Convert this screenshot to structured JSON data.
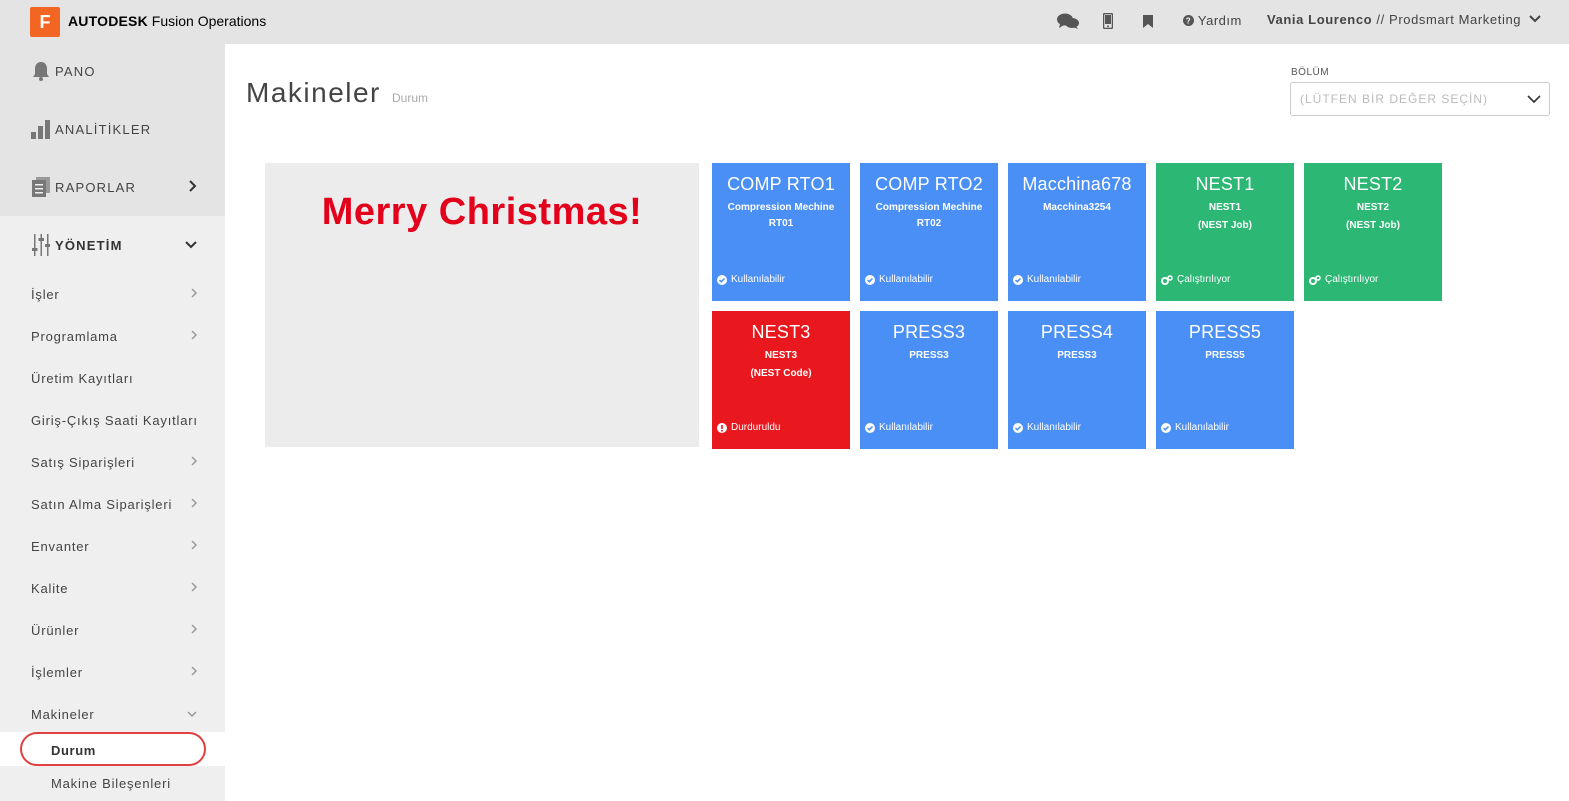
{
  "header": {
    "logo_letter": "F",
    "brand_bold": "AUTODESK",
    "brand_rest": " Fusion Operations",
    "help_label": "Yardım",
    "user_name": "Vania Lourenco",
    "user_company": " // Prodsmart Marketing"
  },
  "sidebar": {
    "main_items": [
      {
        "label": "PANO",
        "icon": "bell-icon"
      },
      {
        "label": "ANALİTİKLER",
        "icon": "bar-chart-icon"
      },
      {
        "label": "RAPORLAR",
        "icon": "documents-icon"
      },
      {
        "label": "YÖNETİM",
        "icon": "sliders-icon"
      }
    ],
    "sub_items": [
      {
        "label": "İşler"
      },
      {
        "label": "Programlama"
      },
      {
        "label": "Üretim Kayıtları"
      },
      {
        "label": "Giriş-Çıkış Saati Kayıtları"
      },
      {
        "label": "Satış Siparişleri"
      },
      {
        "label": "Satın Alma Siparişleri"
      },
      {
        "label": "Envanter"
      },
      {
        "label": "Kalite"
      },
      {
        "label": "Ürünler"
      },
      {
        "label": "İşlemler"
      },
      {
        "label": "Makineler"
      }
    ],
    "leaf_items": [
      {
        "label": "Durum"
      },
      {
        "label": "Makine Bileşenleri"
      }
    ]
  },
  "page": {
    "title": "Makineler",
    "subtitle": "Durum",
    "section_label": "BÖLÜM",
    "section_placeholder": "(LÜTFEN BİR DEĞER SEÇİN)"
  },
  "banner": {
    "text": "Merry Christmas!"
  },
  "machines": [
    {
      "name": "COMP RTO1",
      "desc": "Compression Mechine RT01",
      "job": "",
      "status": "Kullanılabilir",
      "status_type": "available",
      "color": "#4a8ff5"
    },
    {
      "name": "COMP RTO2",
      "desc": "Compression Mechine RT02",
      "job": "",
      "status": "Kullanılabilir",
      "status_type": "available",
      "color": "#4a8ff5"
    },
    {
      "name": "Macchina678",
      "desc": "Macchina3254",
      "job": "",
      "status": "Kullanılabilir",
      "status_type": "available",
      "color": "#4a8ff5"
    },
    {
      "name": "NEST1",
      "desc": "NEST1",
      "job": "(NEST Job)",
      "status": "Çalıştırılıyor",
      "status_type": "running",
      "color": "#2cb774"
    },
    {
      "name": "NEST2",
      "desc": "NEST2",
      "job": "(NEST Job)",
      "status": "Çalıştırılıyor",
      "status_type": "running",
      "color": "#2cb774"
    },
    {
      "name": "NEST3",
      "desc": "NEST3",
      "job": "(NEST Code)",
      "status": "Durduruldu",
      "status_type": "stopped",
      "color": "#e8181e"
    },
    {
      "name": "PRESS3",
      "desc": "PRESS3",
      "job": "",
      "status": "Kullanılabilir",
      "status_type": "available",
      "color": "#4a8ff5"
    },
    {
      "name": "PRESS4",
      "desc": "PRESS3",
      "job": "",
      "status": "Kullanılabilir",
      "status_type": "available",
      "color": "#4a8ff5"
    },
    {
      "name": "PRESS5",
      "desc": "PRESS5",
      "job": "",
      "status": "Kullanılabilir",
      "status_type": "available",
      "color": "#4a8ff5"
    }
  ]
}
